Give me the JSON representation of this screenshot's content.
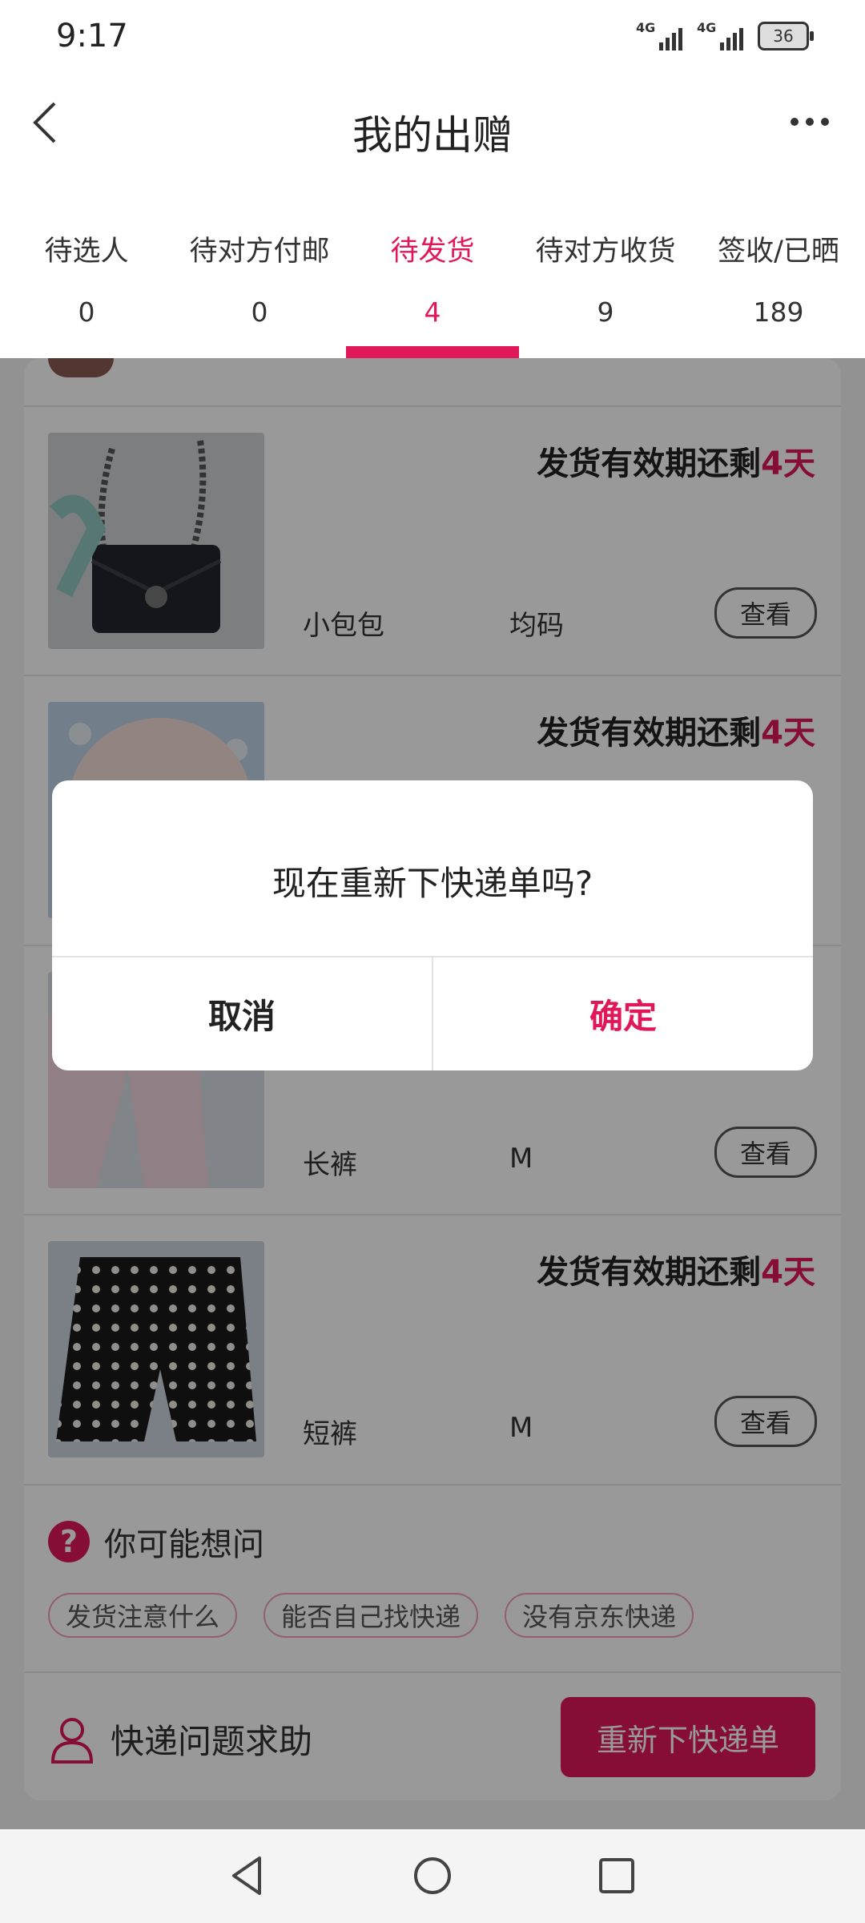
{
  "status_bar": {
    "time": "9:17",
    "network1": "4G",
    "network2": "4G",
    "battery": "36"
  },
  "header": {
    "title": "我的出赠",
    "back_icon": "back-chevron-icon",
    "more_icon": "more-dots-icon"
  },
  "tabs": [
    {
      "label": "待选人",
      "count": "0"
    },
    {
      "label": "待对方付邮",
      "count": "0"
    },
    {
      "label": "待发货",
      "count": "4",
      "active": true
    },
    {
      "label": "待对方收货",
      "count": "9"
    },
    {
      "label": "签收/已晒",
      "count": "189"
    }
  ],
  "items": [
    {
      "deadline_prefix": "发货有效期还剩",
      "deadline_days": "4天",
      "name": "小包包",
      "size": "均码",
      "view_label": "查看"
    },
    {
      "deadline_prefix": "发货有效期还剩",
      "deadline_days": "4天",
      "name": "",
      "size": "",
      "view_label": ""
    },
    {
      "deadline_prefix": "",
      "deadline_days": "",
      "name": "长裤",
      "size": "M",
      "view_label": "查看"
    },
    {
      "deadline_prefix": "发货有效期还剩",
      "deadline_days": "4天",
      "name": "短裤",
      "size": "M",
      "view_label": "查看"
    }
  ],
  "faq": {
    "title": "你可能想问",
    "chips": [
      "发货注意什么",
      "能否自己找快递",
      "没有京东快递"
    ]
  },
  "help": {
    "label": "快递问题求助",
    "button": "重新下快递单"
  },
  "dialog": {
    "message": "现在重新下快递单吗?",
    "cancel": "取消",
    "confirm": "确定"
  },
  "colors": {
    "accent": "#e0185a",
    "overlay": "rgba(0,0,0,0.4)"
  }
}
